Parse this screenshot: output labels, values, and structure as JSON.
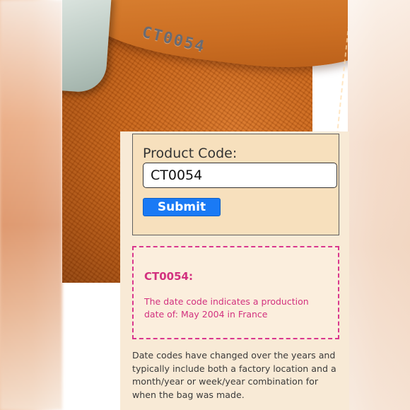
{
  "photo": {
    "stamp_code": "CT0054"
  },
  "form": {
    "label": "Product Code:",
    "input_value": "CT0054",
    "submit_label": "Submit"
  },
  "result": {
    "title": "CT0054:",
    "message": "The date code indicates a production date of: May 2004 in France"
  },
  "info": {
    "text": "Date codes have changed over the years and typically include both a factory location and a month/year or week/year combination for when the bag was made."
  },
  "colors": {
    "submit_button": "#1a7af5",
    "result_accent": "#d2317f",
    "form_background": "#f7e0bd",
    "panel_background": "#f8ead6"
  }
}
